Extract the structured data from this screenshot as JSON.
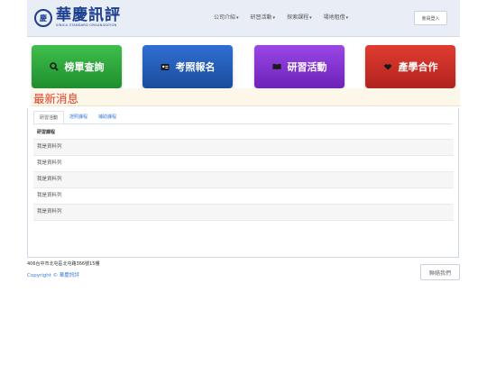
{
  "header": {
    "logo_main": "華慶訊評",
    "logo_sub": "SINICA STANDARD ORGANIZATION",
    "logo_seal": "慶",
    "menu": [
      {
        "label": "公司介紹"
      },
      {
        "label": "研習活動"
      },
      {
        "label": "探索課程"
      },
      {
        "label": "場地租借"
      }
    ],
    "member_login": "會員登入"
  },
  "quick_links": [
    {
      "label": "榜單查詢",
      "icon": "search-icon",
      "color": "#2aa63a"
    },
    {
      "label": "考照報名",
      "icon": "id-card-icon",
      "color": "#245db6"
    },
    {
      "label": "研習活動",
      "icon": "book-icon",
      "color": "#8434d0"
    },
    {
      "label": "產學合作",
      "icon": "handshake-icon",
      "color": "#c92f25"
    }
  ],
  "news": {
    "title": "最新消息",
    "tabs": [
      "研習活動",
      "證照課程",
      "補助課程"
    ],
    "active_tab": "研習活動",
    "section_heading": "研習課程",
    "rows": [
      "我是資料列",
      "我是資料列",
      "我是資料列",
      "我是資料列",
      "我是資料列"
    ]
  },
  "footer": {
    "address": "406台中市北屯區北屯路366號15樓",
    "copyright": "Copyright © 華慶訊評",
    "contact_button": "聯絡我們"
  }
}
